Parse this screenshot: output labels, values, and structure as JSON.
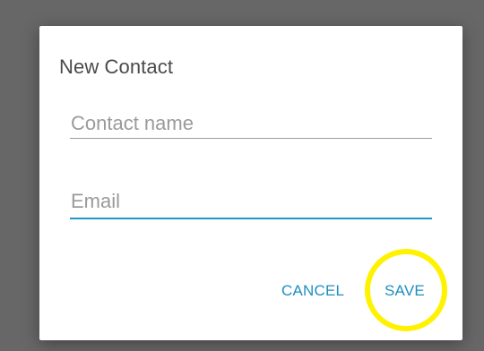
{
  "dialog": {
    "title": "New Contact",
    "fields": {
      "name": {
        "placeholder": "Contact name",
        "value": ""
      },
      "email": {
        "placeholder": "Email",
        "value": ""
      }
    },
    "actions": {
      "cancel_label": "CANCEL",
      "save_label": "SAVE"
    }
  },
  "colors": {
    "accent": "#1e8ec0",
    "focused_underline": "#1c98c5",
    "highlight": "#fff200",
    "scrim": "#676767"
  }
}
